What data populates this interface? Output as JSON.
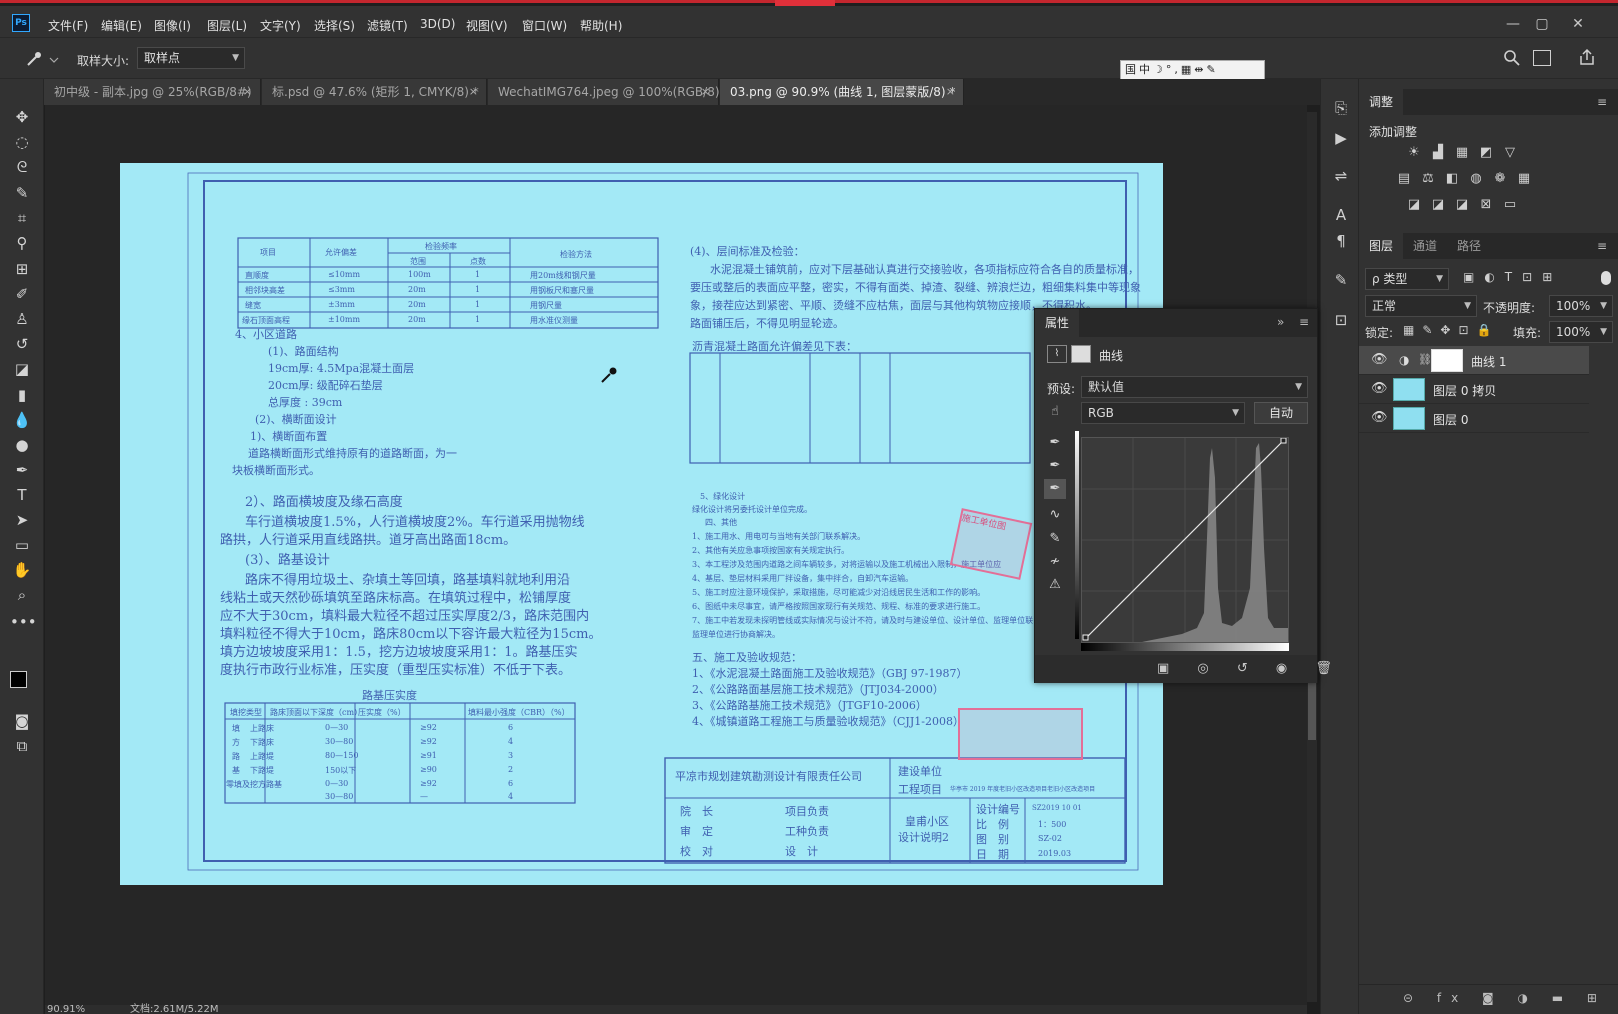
{
  "app": {
    "logo": "Ps"
  },
  "menu": [
    "文件(F)",
    "编辑(E)",
    "图像(I)",
    "图层(L)",
    "文字(Y)",
    "选择(S)",
    "滤镜(T)",
    "3D(D)",
    "视图(V)",
    "窗口(W)",
    "帮助(H)"
  ],
  "window_controls": {
    "minimize": "—",
    "restore": "▢",
    "close": "✕"
  },
  "options_bar": {
    "sample_size_label": "取样大小:",
    "sample_size_value": "取样点",
    "ime_toolbar": "国中☽°,▦⇹✎"
  },
  "tabs": [
    {
      "label": "初中级 - 副本.jpg @ 25%(RGB/8#)",
      "active": false
    },
    {
      "label": "标.psd @ 47.6% (矩形 1, CMYK/8) *",
      "active": false
    },
    {
      "label": "WechatIMG764.jpeg @ 100%(RGB/8)",
      "active": false
    },
    {
      "label": "03.png @ 90.9% (曲线 1, 图层蒙版/8) *",
      "active": true
    }
  ],
  "tab_close_glyph": "×",
  "document": {
    "table1_headers": [
      "项目",
      "允许偏差",
      "检验频率",
      "检验方法"
    ],
    "table1_subheaders": [
      "范围",
      "点数"
    ],
    "table1_rows": [
      [
        "直顺度",
        "≤10mm",
        "100m",
        "1",
        "用20m线和钢尺量"
      ],
      [
        "相邻块高差",
        "≤3mm",
        "20m",
        "1",
        "用钢板尺和塞尺量"
      ],
      [
        "缝宽",
        "±3mm",
        "20m",
        "1",
        "用钢尺量"
      ],
      [
        "缘石顶面高程",
        "±10mm",
        "20m",
        "1",
        "用水准仪测量"
      ]
    ],
    "left_lines": [
      "4、小区道路",
      "(1)、路面结构",
      "19cm厚: 4.5Mpa混凝土面层",
      "20cm厚: 级配碎石垫层",
      "总厚度 : 39cm",
      "(2)、横断面设计",
      "1)、横断面布置",
      "道路横断面形式维持原有的道路断面，为一",
      "块板横断面形式。"
    ],
    "left_big_lines": [
      "2）、路面横坡度及缘石高度",
      "车行道横坡度1.5%，人行道横坡度2%。车行道采用抛物线",
      "路拱，人行道采用直线路拱。道牙高出路面18cm。",
      "(3）、路基设计",
      "路床不得用垃圾土、杂填土等回填，路基填料就地利用沿",
      "线粘土或天然砂砾填筑至路床标高。在填筑过程中，松铺厚度",
      "应不大于30cm，填料最大粒径不超过压实厚度2/3，路床范围内",
      "填料粒径不得大于10cm，路床80cm以下容许最大粒径为15cm。",
      "填方边坡坡度采用1：1.5，挖方边坡坡度采用1：1。路基压实",
      "度执行市政行业标准，压实度（重型压实标准）不低于下表。"
    ],
    "table2_title": "路基压实度",
    "table2_headers": [
      "填挖类型",
      "路床顶面以下深度（cm）",
      "压实度（%）",
      "填料最小强度（CBR）（%）"
    ],
    "table2_rows": [
      [
        "填",
        "上路床",
        "0—30",
        "≥92",
        "6"
      ],
      [
        "方",
        "下路床",
        "30—80",
        "≥92",
        "4"
      ],
      [
        "路",
        "上路堤",
        "80—150",
        "≥91",
        "3"
      ],
      [
        "基",
        "下路堤",
        "150以下",
        "≥90",
        "2"
      ],
      [
        "零填及挖方路基",
        "",
        "0—30",
        "≥92",
        "6"
      ],
      [
        "",
        "",
        "30—80",
        "—",
        "4"
      ]
    ],
    "right_lines": [
      "(4)、层间标准及检验：",
      "水泥混凝土铺筑前，应对下层基础认真进行交接验收，各项指标应符合各自的质量标准，",
      "要压或整后的表面应平整，密实，不得有面类、掉渣、裂缝、辨浪烂边，粗细集料集中等现象",
      "象，接茬应达到紧密、平顺、烫缝不应枯焦，面层与其他构筑物应接顺，不得积水。",
      "路面铺压后，不得见明显轮迹。",
      "沥青混凝土路面允许偏差见下表："
    ],
    "right_lines2": [
      "5、绿化设计",
      "绿化设计将另委托设计单位完成。",
      "四、其他",
      "1、施工用水、用电可与当地有关部门联系解决。",
      "2、其他有关应急事项按国家有关规定执行。",
      "3、本工程涉及范围内道路之间车辆较多，对将运输以及施工机械出入限制，施工单位应",
      "4、基层、垫层材料采用厂拌设备，集中拌合，自卸汽车运输。",
      "5、施工时应注意环境保护，采取措施，尽可能减少对沿线居民生活和工作的影响。",
      "6、图纸中未尽事宜，请严格按照国家现行有关规范、规程、标准的要求进行施工。",
      "7、施工中若发现未探明管线或实际情况与设计不符，请及时与建设单位、设计单位、监理单位联",
      "监理单位进行协商解决。",
      "五、施工及验收规范：",
      "1、《水泥混凝土路面施工及验收规范》（GBJ 97-1987）",
      "2、《公路路面基层施工技术规范》（JTJ034-2000）",
      "3、《公路路基施工技术规范》（JTGF10-2006）",
      "4、《城镇道路工程施工与质量验收规范》（CJJ1-2008）"
    ],
    "title_block": {
      "company": "平凉市规划建筑勘测设计有限责任公司",
      "build_unit_label": "建设单位",
      "project_label": "工程项目",
      "project_value": "华亭市 2019 年度老旧小区改造项目老旧小区改造项目",
      "roles": [
        "院　长",
        "项目负责",
        "审　定",
        "工种负责",
        "校　对",
        "设　计"
      ],
      "sheet_title": "皇甫小区",
      "sheet_subtitle": "设计说明2",
      "meta_labels": [
        "设计编号",
        "比　例",
        "图　别",
        "日　期"
      ],
      "meta_values": [
        "SZ2019 10 01",
        "1：500",
        "SZ-02",
        "2019.03"
      ]
    },
    "stamp_text": "施工单位图"
  },
  "right_dock": {
    "adjustments_tab": "调整",
    "add_adjustment": "添加调整",
    "layer_tabs": [
      "图层",
      "通道",
      "路径"
    ],
    "kind_filter": "ρ 类型",
    "blend_mode": "正常",
    "opacity_label": "不透明度:",
    "opacity_value": "100%",
    "lock_label": "锁定:",
    "fill_label": "填充:",
    "fill_value": "100%",
    "layers": [
      {
        "name": "曲线 1",
        "selected": true
      },
      {
        "name": "图层 0 拷贝",
        "selected": false
      },
      {
        "name": "图层 0",
        "selected": false
      }
    ],
    "bottom_icons": "⊝ fx ◙ ◑ ▬ ⊞ 🗑"
  },
  "properties": {
    "tab": "属性",
    "type_label": "曲线",
    "preset_label": "预设:",
    "preset_value": "默认值",
    "channel_value": "RGB",
    "auto_button": "自动",
    "footer_icons": "▣ ◎ ↺ ◉ 🗑"
  },
  "status": {
    "zoom": "90.91%",
    "doc": "文档:2.61M/5.22M"
  },
  "colors": {
    "app_bg": "#323232",
    "canvas_bg": "#262626",
    "document_bg": "#a3e9f6",
    "doc_ink": "#3f5fb0",
    "accent_red": "#c4262e"
  }
}
